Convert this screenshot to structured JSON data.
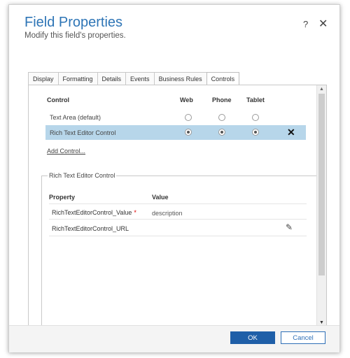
{
  "dialog": {
    "title": "Field Properties",
    "subtitle": "Modify this field's properties.",
    "help_label": "?",
    "close_label": "✕"
  },
  "tabs": [
    {
      "label": "Display"
    },
    {
      "label": "Formatting"
    },
    {
      "label": "Details"
    },
    {
      "label": "Events"
    },
    {
      "label": "Business Rules"
    },
    {
      "label": "Controls",
      "active": true
    }
  ],
  "controls": {
    "headers": {
      "control": "Control",
      "web": "Web",
      "phone": "Phone",
      "tablet": "Tablet"
    },
    "rows": [
      {
        "name": "Text Area (default)",
        "web": false,
        "phone": false,
        "tablet": false,
        "selected": false
      },
      {
        "name": "Rich Text Editor Control",
        "web": true,
        "phone": true,
        "tablet": true,
        "selected": true
      }
    ],
    "remove_label": "✕",
    "add_link": "Add Control..."
  },
  "rte_group": {
    "legend": "Rich Text Editor Control",
    "headers": {
      "property": "Property",
      "value": "Value"
    },
    "rows": [
      {
        "property": "RichTextEditorControl_Value",
        "required": "*",
        "value": "description"
      },
      {
        "property": "RichTextEditorControl_URL",
        "value": ""
      }
    ],
    "edit_icon": "pencil-icon"
  },
  "footer": {
    "ok_label": "OK",
    "cancel_label": "Cancel"
  },
  "colors": {
    "accent": "#2e75b6",
    "selected_row": "#b7d6ea",
    "ok_button": "#1f5fa8"
  }
}
